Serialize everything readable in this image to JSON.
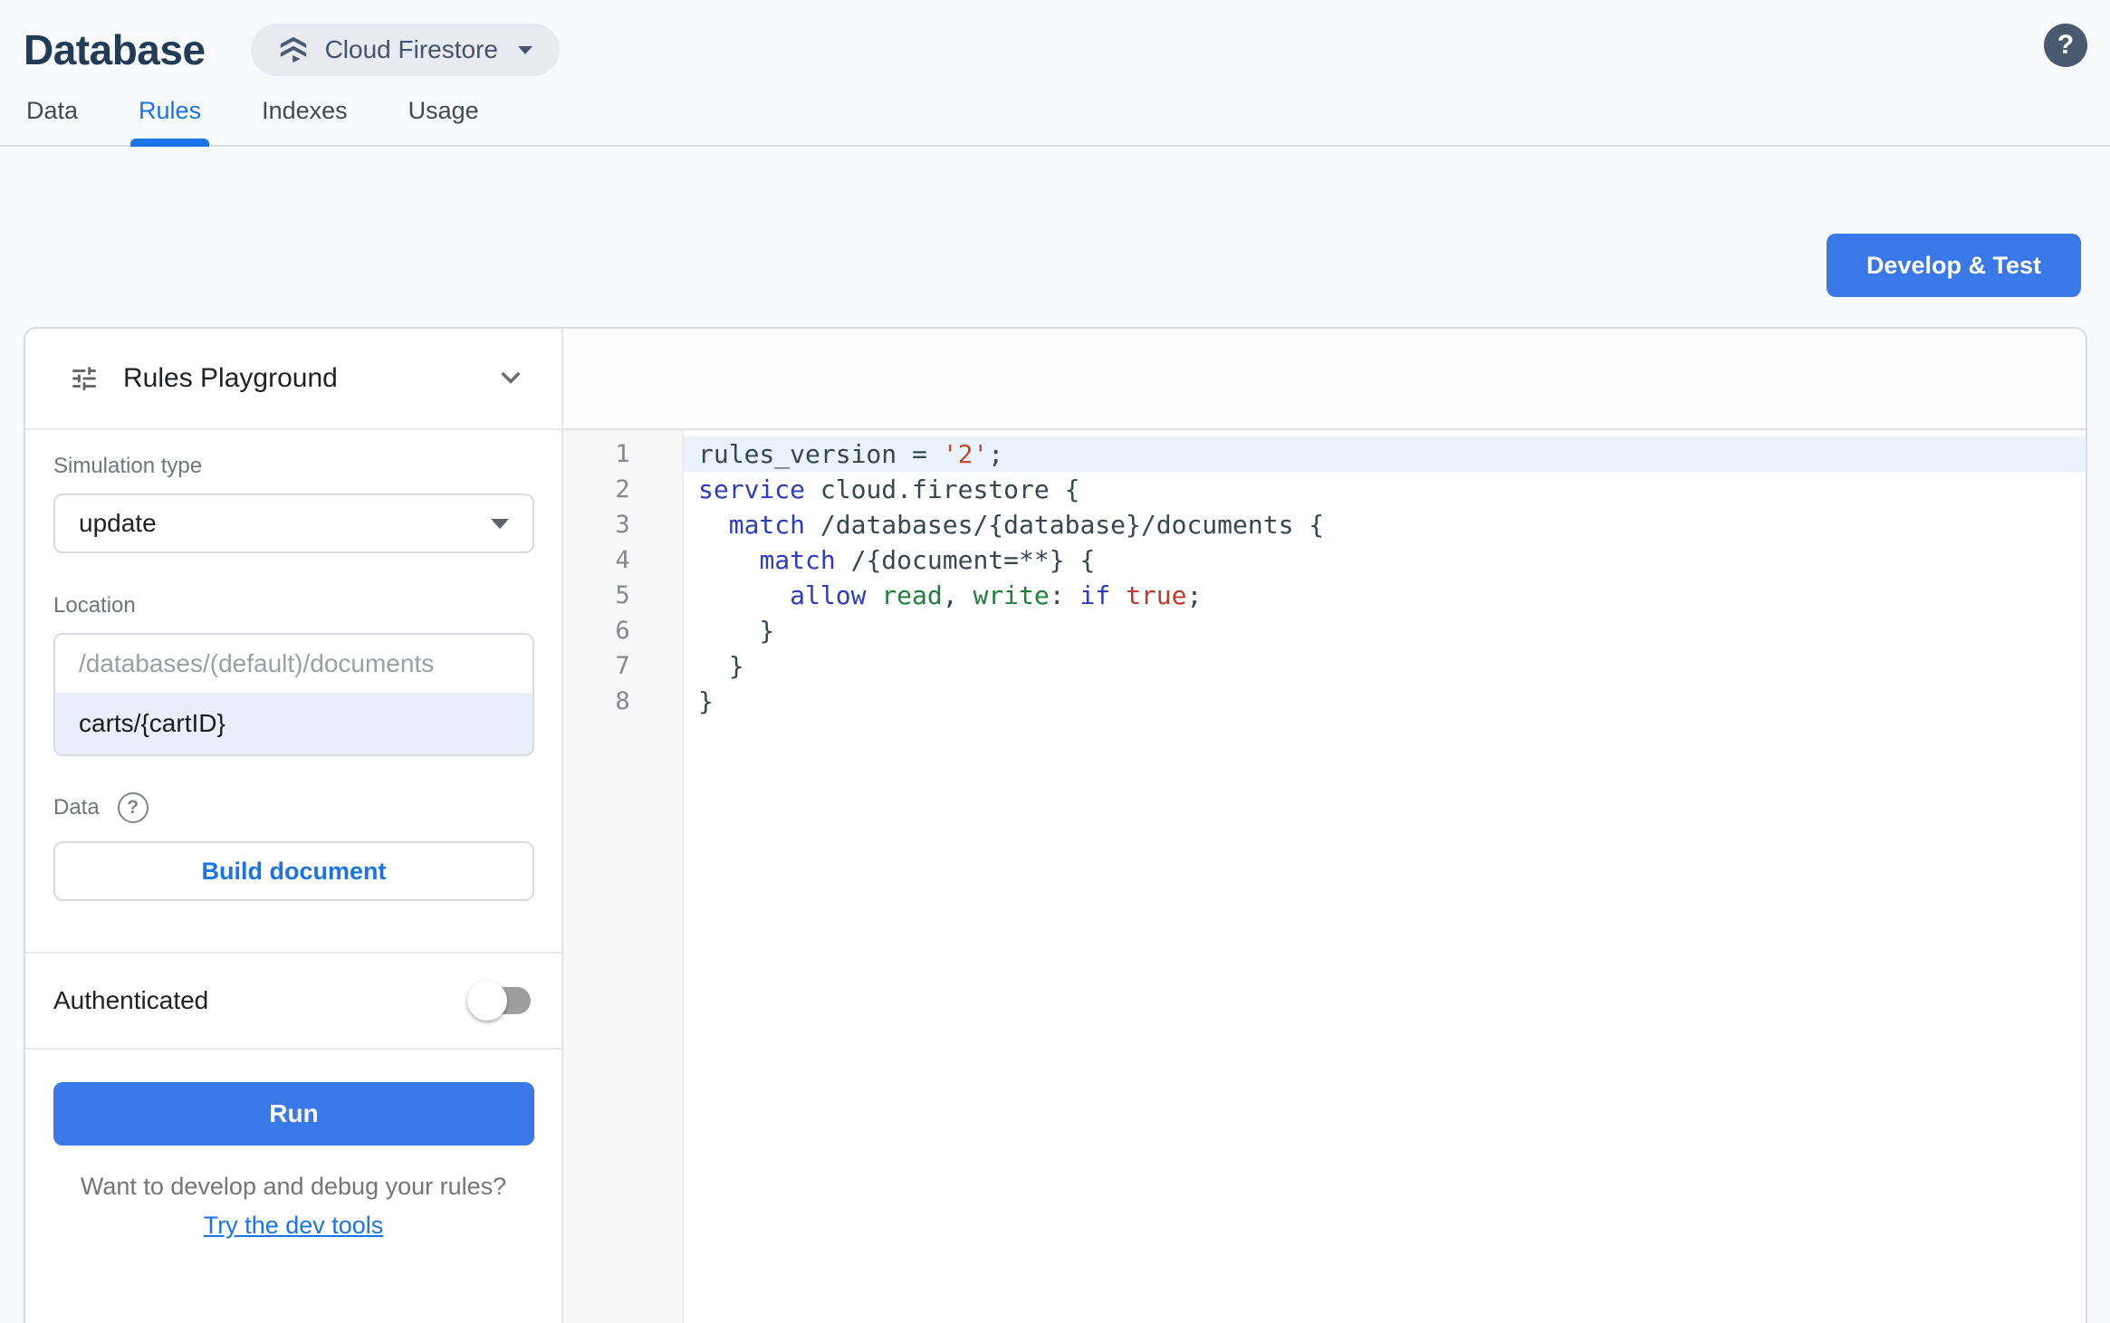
{
  "header": {
    "title": "Database",
    "chip_label": "Cloud Firestore"
  },
  "tabs": [
    {
      "label": "Data",
      "active": false
    },
    {
      "label": "Rules",
      "active": true
    },
    {
      "label": "Indexes",
      "active": false
    },
    {
      "label": "Usage",
      "active": false
    }
  ],
  "actions": {
    "develop_test_label": "Develop & Test"
  },
  "playground": {
    "title": "Rules Playground",
    "simulation_type": {
      "label": "Simulation type",
      "value": "update"
    },
    "location": {
      "label": "Location",
      "base_path_placeholder": "/databases/(default)/documents",
      "path_value": "carts/{cartID}"
    },
    "data_section": {
      "label": "Data",
      "build_button_label": "Build document"
    },
    "authenticated": {
      "label": "Authenticated",
      "enabled": false
    },
    "run_button_label": "Run",
    "footer": {
      "question": "Want to develop and debug your rules?",
      "link_label": "Try the dev tools"
    }
  },
  "editor": {
    "lines": [
      {
        "number": 1,
        "highlight": true,
        "tokens": [
          {
            "t": "rules_version = "
          },
          {
            "t": "'2'",
            "c": "s"
          },
          {
            "t": ";"
          }
        ]
      },
      {
        "number": 2,
        "highlight": false,
        "tokens": [
          {
            "t": "service",
            "c": "k"
          },
          {
            "t": " cloud.firestore {"
          }
        ]
      },
      {
        "number": 3,
        "highlight": false,
        "tokens": [
          {
            "t": "  "
          },
          {
            "t": "match",
            "c": "k"
          },
          {
            "t": " /databases/{database}/documents {"
          }
        ]
      },
      {
        "number": 4,
        "highlight": false,
        "tokens": [
          {
            "t": "    "
          },
          {
            "t": "match",
            "c": "k"
          },
          {
            "t": " /{document=**} {"
          }
        ]
      },
      {
        "number": 5,
        "highlight": false,
        "tokens": [
          {
            "t": "      "
          },
          {
            "t": "allow",
            "c": "k"
          },
          {
            "t": " "
          },
          {
            "t": "read",
            "c": "g"
          },
          {
            "t": ", "
          },
          {
            "t": "write",
            "c": "g"
          },
          {
            "t": ": "
          },
          {
            "t": "if",
            "c": "k"
          },
          {
            "t": " "
          },
          {
            "t": "true",
            "c": "r"
          },
          {
            "t": ";"
          }
        ]
      },
      {
        "number": 6,
        "highlight": false,
        "tokens": [
          {
            "t": "    }"
          }
        ]
      },
      {
        "number": 7,
        "highlight": false,
        "tokens": [
          {
            "t": "  }"
          }
        ]
      },
      {
        "number": 8,
        "highlight": false,
        "tokens": [
          {
            "t": "}"
          }
        ]
      }
    ]
  },
  "icons": {
    "chip_icon": "firestore-icon",
    "header_help": "help-icon",
    "playground_icon": "tune-icon",
    "collapse": "chevron-down-icon"
  },
  "colors": {
    "page_background": "#f8f9fa",
    "accent_blue": "#1a73e8",
    "button_blue": "#3b78e7",
    "title_navy": "#223c58",
    "chip_background": "#e8eaf1",
    "active_line_highlight": "#eaf2fc",
    "location_row_highlight": "#e8eefb",
    "code_keyword": "#2c3cbd",
    "code_permission_green": "#1f7e38",
    "code_string_orange": "#c14b2b",
    "code_literal_red": "#c0392b"
  }
}
